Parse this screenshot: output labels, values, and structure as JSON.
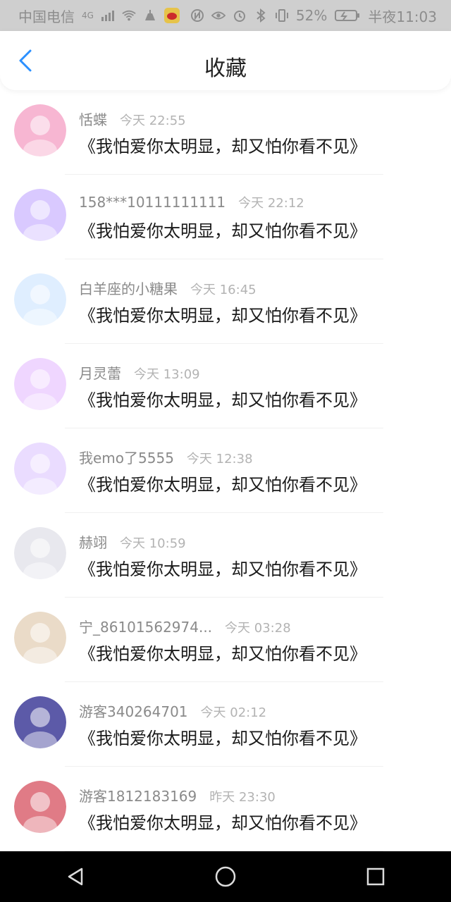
{
  "status_bar": {
    "carrier": "中国电信",
    "network": "4G",
    "battery_percent": "52%",
    "time": "半夜11:03"
  },
  "header": {
    "title": "收藏"
  },
  "items": [
    {
      "name": "恬蝶",
      "time": "今天 22:55",
      "message": "《我怕爱你太明显，却又怕你看不见》",
      "avatar_color": "#f7b6d2"
    },
    {
      "name": "158***10111111111",
      "time": "今天 22:12",
      "message": "《我怕爱你太明显，却又怕你看不见》",
      "avatar_color": "#d9c9ff"
    },
    {
      "name": "白羊座的小糖果",
      "time": "今天 16:45",
      "message": "《我怕爱你太明显，却又怕你看不见》",
      "avatar_color": "#dfeeff"
    },
    {
      "name": "月灵蕾",
      "time": "今天 13:09",
      "message": "《我怕爱你太明显，却又怕你看不见》",
      "avatar_color": "#efd6ff"
    },
    {
      "name": "我emo了5555",
      "time": "今天 12:38",
      "message": "《我怕爱你太明显，却又怕你看不见》",
      "avatar_color": "#eadcff"
    },
    {
      "name": "赫翊",
      "time": "今天 10:59",
      "message": "《我怕爱你太明显，却又怕你看不见》",
      "avatar_color": "#e8e8ee"
    },
    {
      "name": "宁_86101562974...",
      "time": "今天 03:28",
      "message": "《我怕爱你太明显，却又怕你看不见》",
      "avatar_color": "#eadbc8"
    },
    {
      "name": "游客340264701",
      "time": "今天 02:12",
      "message": "《我怕爱你太明显，却又怕你看不见》",
      "avatar_color": "#5c5aa8"
    },
    {
      "name": "游客1812183169",
      "time": "昨天 23:30",
      "message": "《我怕爱你太明显，却又怕你看不见》",
      "avatar_color": "#e07b86"
    }
  ]
}
